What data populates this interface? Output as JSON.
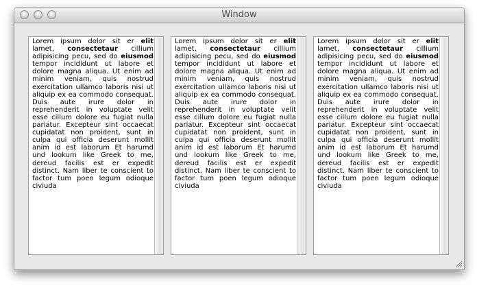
{
  "window": {
    "title": "Window"
  },
  "panes": [
    {
      "segments": [
        {
          "text": "Lorem ipsum dolor sit er ",
          "bold": false
        },
        {
          "text": "elit",
          "bold": true
        },
        {
          "text": " lamet, ",
          "bold": false
        },
        {
          "text": "consectetaur",
          "bold": true
        },
        {
          "text": " cillium adipisicing pecu, sed do ",
          "bold": false
        },
        {
          "text": "eiusmod",
          "bold": true
        },
        {
          "text": " tempor incididunt ut labore et dolore magna aliqua. Ut enim ad minim veniam, quis nostrud exercitation ullamco laboris nisi ut aliquip ex ea commodo consequat. Duis aute irure dolor in reprehenderit in voluptate velit esse cillum dolore eu fugiat nulla pariatur. Excepteur sint occaecat cupidatat non proident, sunt in culpa qui officia deserunt mollit anim id est laborum Et harumd und lookum like Greek to me, dereud facilis est er expedit distinct. Nam liber te conscient to factor tum poen legum odioque civiuda",
          "bold": false
        }
      ]
    },
    {
      "segments": [
        {
          "text": "Lorem ipsum dolor sit er ",
          "bold": false
        },
        {
          "text": "elit",
          "bold": true
        },
        {
          "text": " lamet, ",
          "bold": false
        },
        {
          "text": "consectetaur",
          "bold": true
        },
        {
          "text": " cillium adipisicing pecu, sed do ",
          "bold": false
        },
        {
          "text": "eiusmod",
          "bold": true
        },
        {
          "text": " tempor incididunt ut labore et dolore magna aliqua. Ut enim ad minim veniam, quis nostrud exercitation ullamco laboris nisi ut aliquip ex ea commodo consequat. Duis aute irure dolor in reprehenderit in voluptate velit esse cillum dolore eu fugiat nulla pariatur. Excepteur sint occaecat cupidatat non proident, sunt in culpa qui officia deserunt mollit anim id est laborum Et harumd und lookum like Greek to me, dereud facilis est er expedit distinct. Nam liber te conscient to factor tum poen legum odioque civiuda",
          "bold": false
        }
      ]
    },
    {
      "segments": [
        {
          "text": "Lorem ipsum dolor sit er ",
          "bold": false
        },
        {
          "text": "elit",
          "bold": true
        },
        {
          "text": " lamet, ",
          "bold": false
        },
        {
          "text": "consectetaur",
          "bold": true
        },
        {
          "text": " cillium adipisicing pecu, sed do ",
          "bold": false
        },
        {
          "text": "eiusmod",
          "bold": true
        },
        {
          "text": " tempor incididunt ut labore et dolore magna aliqua. Ut enim ad minim veniam, quis nostrud exercitation ullamco laboris nisi ut aliquip ex ea commodo consequat. Duis aute irure dolor in reprehenderit in voluptate velit esse cillum dolore eu fugiat nulla pariatur. Excepteur sint occaecat cupidatat non proident, sunt in culpa qui officia deserunt mollit anim id est laborum Et harumd und lookum like Greek to me, dereud facilis est er expedit distinct. Nam liber te conscient to factor tum poen legum odioque civiuda",
          "bold": false
        }
      ]
    }
  ],
  "icons": {
    "close": "close-icon",
    "minimize": "minimize-icon",
    "zoom": "zoom-icon",
    "resize": "resize-grip-icon"
  }
}
